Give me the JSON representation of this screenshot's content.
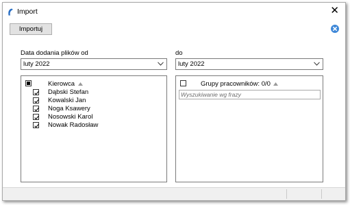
{
  "window": {
    "title": "Import",
    "close_symbol": "✕"
  },
  "toolbar": {
    "import_label": "Importuj"
  },
  "filters": {
    "from_label": "Data dodania plików od",
    "from_value": "luty 2022",
    "to_label": "do",
    "to_value": "luty 2022"
  },
  "drivers": {
    "header": "Kierowca",
    "items": [
      {
        "name": "Dąbski Stefan",
        "checked": true
      },
      {
        "name": "Kowalski Jan",
        "checked": true
      },
      {
        "name": "Noga Ksawery",
        "checked": true
      },
      {
        "name": "Nosowski Karol",
        "checked": true
      },
      {
        "name": "Nowak Radosław",
        "checked": true
      }
    ]
  },
  "groups": {
    "header": "Grupy pracowników: 0/0",
    "search_placeholder": "Wyszukiwanie wg frazy"
  },
  "colors": {
    "accent": "#3f88d8",
    "border": "#7a7a7a",
    "statusbar": "#f0f0f0"
  },
  "icons": [
    "app-icon",
    "close-icon",
    "close-circle-icon",
    "chevron-down-icon",
    "sort-up-icon",
    "checkbox-icon"
  ]
}
